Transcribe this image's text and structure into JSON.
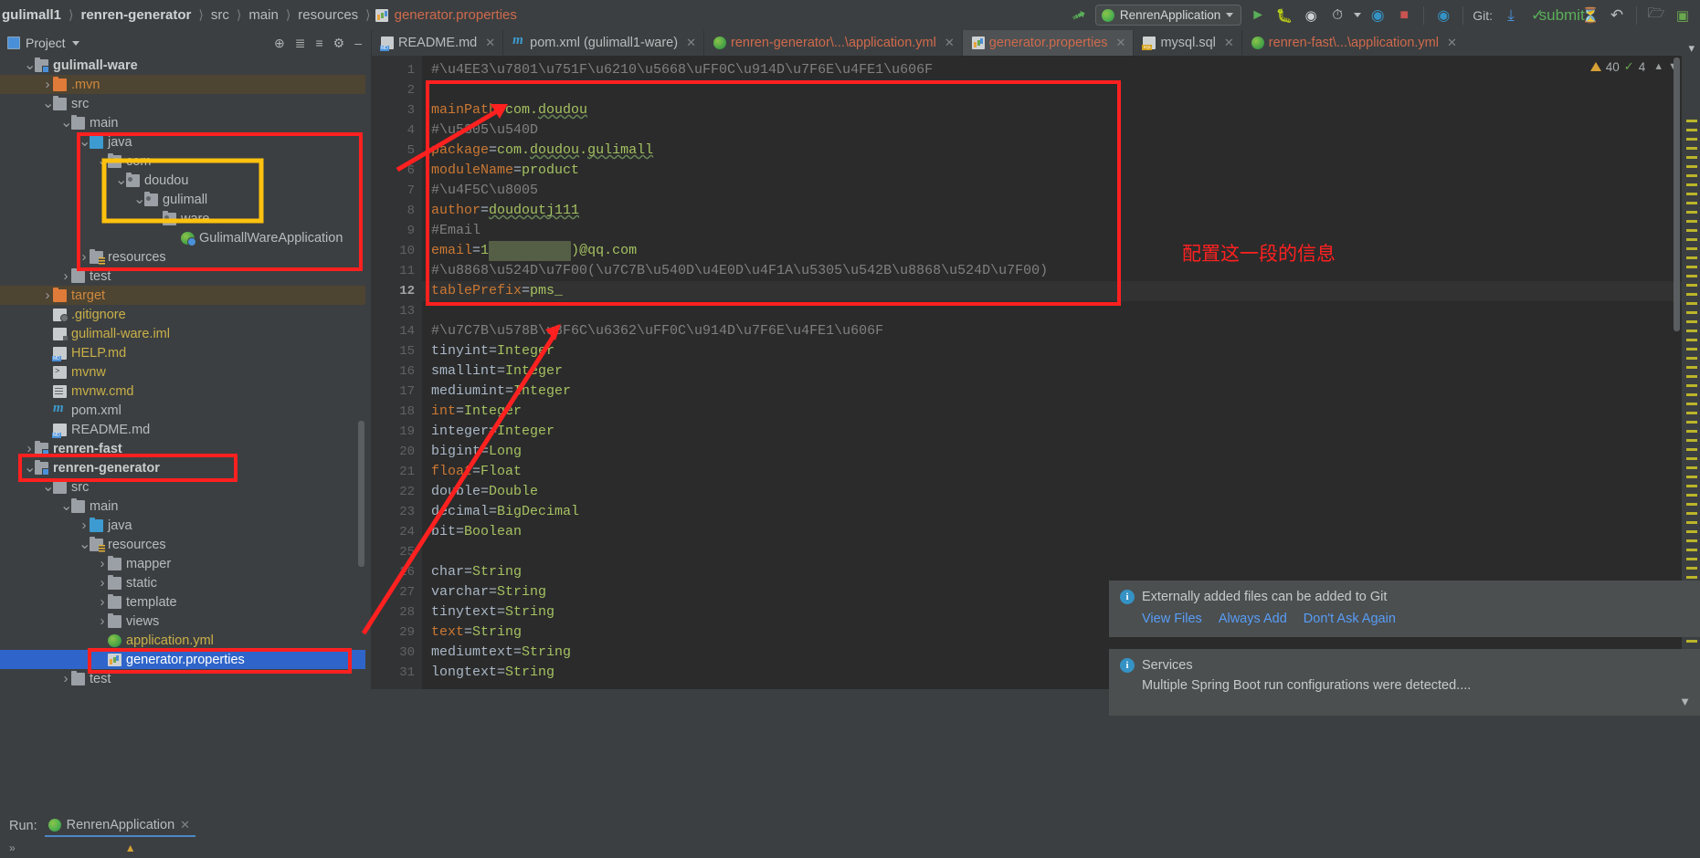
{
  "window": {
    "breadcrumb": [
      {
        "label": "gulimall1",
        "type": "project"
      },
      {
        "label": "renren-generator",
        "type": "module"
      },
      {
        "label": "src",
        "type": "dir"
      },
      {
        "label": "main",
        "type": "dir"
      },
      {
        "label": "resources",
        "type": "dir"
      },
      {
        "label": "generator.properties",
        "type": "file",
        "icon": "properties-icon"
      }
    ],
    "run_config": "RenrenApplication",
    "git_label": "Git:"
  },
  "project_panel": {
    "title": "Project",
    "tree": [
      {
        "indent": 1,
        "arrow": "down",
        "icon": "module-folder-icon",
        "label": "gulimall-ware",
        "style": "bold"
      },
      {
        "indent": 2,
        "arrow": "right",
        "icon": "folder-orange-icon",
        "label": ".mvn",
        "style": "orange",
        "highlight": "brown"
      },
      {
        "indent": 2,
        "arrow": "down",
        "icon": "folder-gray-icon",
        "label": "src",
        "style": "normal"
      },
      {
        "indent": 3,
        "arrow": "down",
        "icon": "folder-gray-icon",
        "label": "main",
        "style": "normal"
      },
      {
        "indent": 4,
        "arrow": "down",
        "icon": "folder-source-icon",
        "label": "java",
        "style": "normal"
      },
      {
        "indent": 5,
        "arrow": "down",
        "icon": "package-icon",
        "label": "com",
        "style": "normal"
      },
      {
        "indent": 6,
        "arrow": "down",
        "icon": "package-icon",
        "label": "doudou",
        "style": "normal"
      },
      {
        "indent": 7,
        "arrow": "down",
        "icon": "package-icon",
        "label": "gulimall",
        "style": "normal"
      },
      {
        "indent": 8,
        "arrow": "down",
        "icon": "package-icon",
        "label": "ware",
        "style": "normal"
      },
      {
        "indent": 9,
        "arrow": "none",
        "icon": "spring-class-icon",
        "label": "GulimallWareApplication",
        "style": "normal"
      },
      {
        "indent": 4,
        "arrow": "right",
        "icon": "resources-folder-icon",
        "label": "resources",
        "style": "normal"
      },
      {
        "indent": 3,
        "arrow": "right",
        "icon": "folder-gray-icon",
        "label": "test",
        "style": "normal"
      },
      {
        "indent": 2,
        "arrow": "right",
        "icon": "folder-orange-icon",
        "label": "target",
        "style": "orange",
        "highlight": "brown"
      },
      {
        "indent": 2,
        "arrow": "none",
        "icon": "gitignore-icon",
        "label": ".gitignore",
        "style": "yellow"
      },
      {
        "indent": 2,
        "arrow": "none",
        "icon": "iml-icon",
        "label": "gulimall-ware.iml",
        "style": "yellow"
      },
      {
        "indent": 2,
        "arrow": "none",
        "icon": "markdown-icon",
        "label": "HELP.md",
        "style": "yellow"
      },
      {
        "indent": 2,
        "arrow": "none",
        "icon": "shell-icon",
        "label": "mvnw",
        "style": "yellow"
      },
      {
        "indent": 2,
        "arrow": "none",
        "icon": "cmd-icon",
        "label": "mvnw.cmd",
        "style": "yellow"
      },
      {
        "indent": 2,
        "arrow": "none",
        "icon": "maven-icon",
        "label": "pom.xml",
        "style": "normal"
      },
      {
        "indent": 2,
        "arrow": "none",
        "icon": "markdown-icon",
        "label": "README.md",
        "style": "normal"
      },
      {
        "indent": 1,
        "arrow": "right",
        "icon": "module-folder-icon",
        "label": "renren-fast",
        "style": "bold"
      },
      {
        "indent": 1,
        "arrow": "down",
        "icon": "module-folder-icon",
        "label": "renren-generator",
        "style": "bold"
      },
      {
        "indent": 2,
        "arrow": "down",
        "icon": "folder-gray-icon",
        "label": "src",
        "style": "normal"
      },
      {
        "indent": 3,
        "arrow": "down",
        "icon": "folder-gray-icon",
        "label": "main",
        "style": "normal"
      },
      {
        "indent": 4,
        "arrow": "right",
        "icon": "folder-source-icon",
        "label": "java",
        "style": "normal"
      },
      {
        "indent": 4,
        "arrow": "down",
        "icon": "resources-folder-icon",
        "label": "resources",
        "style": "normal"
      },
      {
        "indent": 5,
        "arrow": "right",
        "icon": "folder-gray-icon",
        "label": "mapper",
        "style": "normal"
      },
      {
        "indent": 5,
        "arrow": "right",
        "icon": "folder-gray-icon",
        "label": "static",
        "style": "normal"
      },
      {
        "indent": 5,
        "arrow": "right",
        "icon": "folder-gray-icon",
        "label": "template",
        "style": "normal"
      },
      {
        "indent": 5,
        "arrow": "right",
        "icon": "folder-gray-icon",
        "label": "views",
        "style": "normal"
      },
      {
        "indent": 5,
        "arrow": "none",
        "icon": "yaml-spring-icon",
        "label": "application.yml",
        "style": "yellow"
      },
      {
        "indent": 5,
        "arrow": "none",
        "icon": "properties-icon",
        "label": "generator.properties",
        "style": "normal",
        "selected": true
      },
      {
        "indent": 3,
        "arrow": "right",
        "icon": "folder-gray-icon",
        "label": "test",
        "style": "normal"
      }
    ]
  },
  "editor_tabs": [
    {
      "label": "README.md",
      "icon": "markdown-icon",
      "color": "gray",
      "active": false
    },
    {
      "label": "pom.xml (gulimall1-ware)",
      "icon": "maven-icon",
      "color": "gray",
      "active": false
    },
    {
      "label": "renren-generator\\...\\application.yml",
      "icon": "yaml-spring-icon",
      "color": "red",
      "active": false
    },
    {
      "label": "generator.properties",
      "icon": "properties-icon",
      "color": "red",
      "active": true
    },
    {
      "label": "mysql.sql",
      "icon": "sql-icon",
      "color": "gray",
      "active": false
    },
    {
      "label": "renren-fast\\...\\application.yml",
      "icon": "yaml-spring-icon",
      "color": "red",
      "active": false
    }
  ],
  "editor": {
    "filename": "generator.properties",
    "current_line": 12,
    "inspections": {
      "warnings": "40",
      "checks": "4"
    },
    "lines": [
      {
        "n": 1,
        "segments": [
          {
            "t": "#\\u4EE3\\u7801\\u751F\\u6210\\u5668\\uFF0C\\u914D\\u7F6E\\u4FE1\\u606F",
            "k": "cmt"
          }
        ]
      },
      {
        "n": 2,
        "segments": []
      },
      {
        "n": 3,
        "segments": [
          {
            "t": "mainPath",
            "k": "key"
          },
          {
            "t": "=",
            "k": "eq"
          },
          {
            "t": "com.",
            "k": "str"
          },
          {
            "t": "doudou",
            "k": "str-wavy"
          }
        ]
      },
      {
        "n": 4,
        "segments": [
          {
            "t": "#\\u5305\\u540D",
            "k": "cmt"
          }
        ]
      },
      {
        "n": 5,
        "segments": [
          {
            "t": "package",
            "k": "key"
          },
          {
            "t": "=",
            "k": "eq"
          },
          {
            "t": "com.",
            "k": "str"
          },
          {
            "t": "doudou",
            "k": "str-wavy"
          },
          {
            "t": ".",
            "k": "str"
          },
          {
            "t": "gulimall",
            "k": "str-wavy"
          }
        ]
      },
      {
        "n": 6,
        "segments": [
          {
            "t": "moduleName",
            "k": "key"
          },
          {
            "t": "=",
            "k": "eq"
          },
          {
            "t": "product",
            "k": "str"
          }
        ]
      },
      {
        "n": 7,
        "segments": [
          {
            "t": "#\\u4F5C\\u8005",
            "k": "cmt"
          }
        ]
      },
      {
        "n": 8,
        "segments": [
          {
            "t": "author",
            "k": "key"
          },
          {
            "t": "=",
            "k": "eq"
          },
          {
            "t": "doudoutj111",
            "k": "str-wavy"
          }
        ]
      },
      {
        "n": 9,
        "segments": [
          {
            "t": "#Email",
            "k": "cmt"
          }
        ]
      },
      {
        "n": 10,
        "segments": [
          {
            "t": "email",
            "k": "key"
          },
          {
            "t": "=",
            "k": "eq"
          },
          {
            "t": "1",
            "k": "str"
          },
          {
            "t": "XXXXXXXXXX",
            "k": "blur"
          },
          {
            "t": ")@qq.com",
            "k": "str"
          }
        ]
      },
      {
        "n": 11,
        "segments": [
          {
            "t": "#\\u8868\\u524D\\u7F00(\\u7C7B\\u540D\\u4E0D\\u4F1A\\u5305\\u542B\\u8868\\u524D\\u7F00)",
            "k": "cmt"
          }
        ]
      },
      {
        "n": 12,
        "segments": [
          {
            "t": "tablePrefix",
            "k": "key"
          },
          {
            "t": "=",
            "k": "eq"
          },
          {
            "t": "pms_",
            "k": "str"
          }
        ],
        "current": true
      },
      {
        "n": 13,
        "segments": []
      },
      {
        "n": 14,
        "segments": [
          {
            "t": "#\\u7C7B\\u578B\\u8F6C\\u6362\\uFF0C\\u914D\\u7F6E\\u4FE1\\u606F",
            "k": "cmt"
          }
        ]
      },
      {
        "n": 15,
        "segments": [
          {
            "t": "tinyint",
            "k": "val"
          },
          {
            "t": "=",
            "k": "eq"
          },
          {
            "t": "Integer",
            "k": "str"
          }
        ]
      },
      {
        "n": 16,
        "segments": [
          {
            "t": "smallint",
            "k": "val"
          },
          {
            "t": "=",
            "k": "eq"
          },
          {
            "t": "Integer",
            "k": "str"
          }
        ]
      },
      {
        "n": 17,
        "segments": [
          {
            "t": "mediumint",
            "k": "val"
          },
          {
            "t": "=",
            "k": "eq"
          },
          {
            "t": "Integer",
            "k": "str"
          }
        ]
      },
      {
        "n": 18,
        "segments": [
          {
            "t": "int",
            "k": "key"
          },
          {
            "t": "=",
            "k": "eq"
          },
          {
            "t": "Integer",
            "k": "str"
          }
        ]
      },
      {
        "n": 19,
        "segments": [
          {
            "t": "integer",
            "k": "val"
          },
          {
            "t": "=",
            "k": "eq"
          },
          {
            "t": "Integer",
            "k": "str"
          }
        ]
      },
      {
        "n": 20,
        "segments": [
          {
            "t": "bigint",
            "k": "val"
          },
          {
            "t": "=",
            "k": "eq"
          },
          {
            "t": "Long",
            "k": "str"
          }
        ]
      },
      {
        "n": 21,
        "segments": [
          {
            "t": "float",
            "k": "key"
          },
          {
            "t": "=",
            "k": "eq"
          },
          {
            "t": "Float",
            "k": "str"
          }
        ]
      },
      {
        "n": 22,
        "segments": [
          {
            "t": "double",
            "k": "val"
          },
          {
            "t": "=",
            "k": "eq"
          },
          {
            "t": "Double",
            "k": "str"
          }
        ]
      },
      {
        "n": 23,
        "segments": [
          {
            "t": "decimal",
            "k": "val"
          },
          {
            "t": "=",
            "k": "eq"
          },
          {
            "t": "BigDecimal",
            "k": "str"
          }
        ]
      },
      {
        "n": 24,
        "segments": [
          {
            "t": "bit",
            "k": "val"
          },
          {
            "t": "=",
            "k": "eq"
          },
          {
            "t": "Boolean",
            "k": "str"
          }
        ]
      },
      {
        "n": 25,
        "segments": []
      },
      {
        "n": 26,
        "segments": [
          {
            "t": "char",
            "k": "val"
          },
          {
            "t": "=",
            "k": "eq"
          },
          {
            "t": "String",
            "k": "str"
          }
        ]
      },
      {
        "n": 27,
        "segments": [
          {
            "t": "varchar",
            "k": "val"
          },
          {
            "t": "=",
            "k": "eq"
          },
          {
            "t": "String",
            "k": "str"
          }
        ]
      },
      {
        "n": 28,
        "segments": [
          {
            "t": "tinytext",
            "k": "val"
          },
          {
            "t": "=",
            "k": "eq"
          },
          {
            "t": "String",
            "k": "str"
          }
        ]
      },
      {
        "n": 29,
        "segments": [
          {
            "t": "text",
            "k": "key"
          },
          {
            "t": "=",
            "k": "eq"
          },
          {
            "t": "String",
            "k": "str"
          }
        ]
      },
      {
        "n": 30,
        "segments": [
          {
            "t": "mediumtext",
            "k": "val"
          },
          {
            "t": "=",
            "k": "eq"
          },
          {
            "t": "String",
            "k": "str"
          }
        ]
      },
      {
        "n": 31,
        "segments": [
          {
            "t": "longtext",
            "k": "val"
          },
          {
            "t": "=",
            "k": "eq"
          },
          {
            "t": "String",
            "k": "str"
          }
        ]
      }
    ]
  },
  "annotations": {
    "note_text": "配置这一段的信息"
  },
  "notifications": [
    {
      "title": "Externally added files can be added to Git",
      "links": [
        "View Files",
        "Always Add",
        "Don't Ask Again"
      ],
      "body": ""
    },
    {
      "title": "Services",
      "links": [],
      "body": "Multiple Spring Boot run configurations were detected...."
    }
  ],
  "run_panel": {
    "label": "Run:",
    "config_name": "RenrenApplication"
  }
}
